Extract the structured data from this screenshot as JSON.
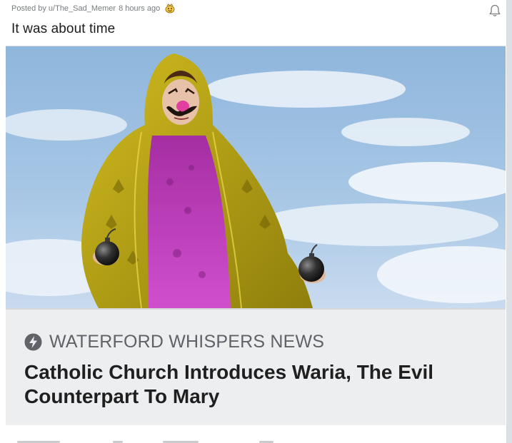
{
  "post": {
    "posted_by_prefix": "Posted by",
    "author": "u/The_Sad_Memer",
    "time": "8 hours ago",
    "title": "It was about time"
  },
  "article": {
    "source": "WATERFORD WHISPERS NEWS",
    "headline": "Catholic Church Introduces Waria, The Evil Counterpart To Mary"
  },
  "icons": {
    "award": "award-icon",
    "bell": "bell-icon",
    "source": "bolt-icon"
  },
  "colors": {
    "meta_text": "#787c7e",
    "title_text": "#1c1c1c",
    "card_background": "#eceef0",
    "source_text": "#5f6368",
    "headline_text": "#1f1f1f",
    "robe_magenta": "#c43fc0",
    "cloak_yellow": "#b8a414"
  }
}
